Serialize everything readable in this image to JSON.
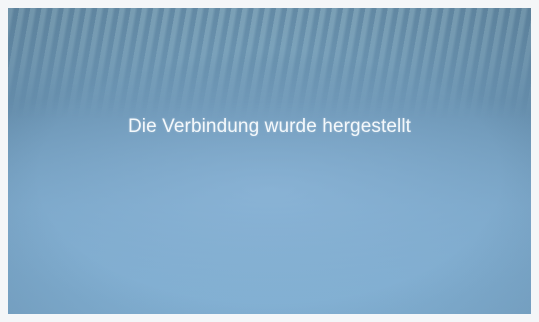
{
  "screen": {
    "message": "Die Verbindung wurde hergestellt"
  },
  "colors": {
    "background": "#7aa6c8",
    "text": "#f4f8fb"
  }
}
